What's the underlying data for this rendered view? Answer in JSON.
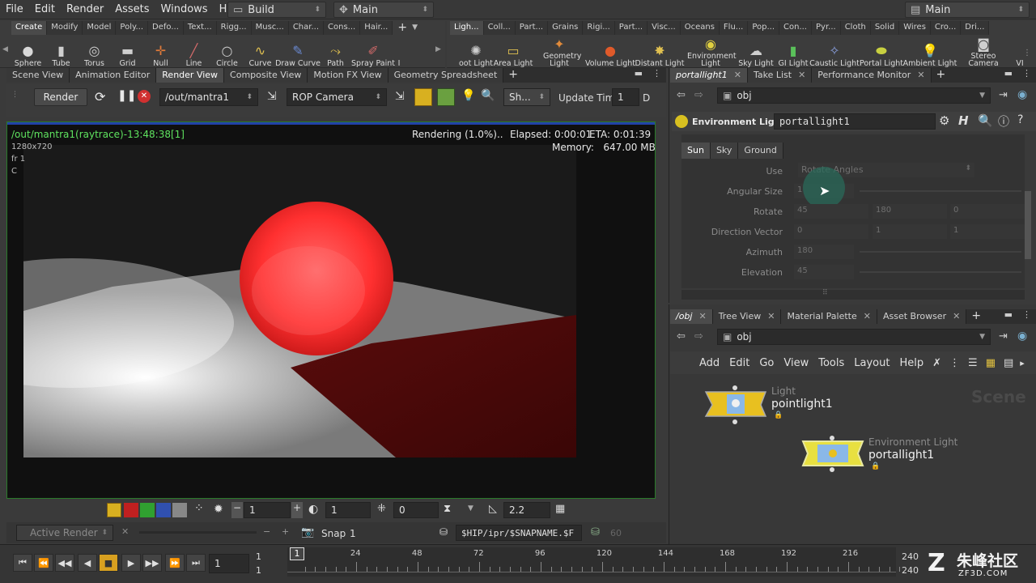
{
  "menubar": {
    "items": [
      "File",
      "Edit",
      "Render",
      "Assets",
      "Windows",
      "Help"
    ],
    "build_desk": "Build",
    "main_desk": "Main",
    "right_desk": "Main"
  },
  "shelf_left": {
    "tabs": [
      "Create",
      "Modify",
      "Model",
      "Poly...",
      "Defo...",
      "Text...",
      "Rigg...",
      "Musc...",
      "Char...",
      "Cons...",
      "Hair..."
    ],
    "tools": [
      "Sphere",
      "Tube",
      "Torus",
      "Grid",
      "Null",
      "Line",
      "Circle",
      "Curve",
      "Draw Curve",
      "Path",
      "Spray Paint",
      "I"
    ]
  },
  "shelf_right": {
    "tabs": [
      "Ligh...",
      "Coll...",
      "Part...",
      "Grains",
      "Rigi...",
      "Part...",
      "Visc...",
      "Oceans",
      "Flu...",
      "Pop...",
      "Con...",
      "Pyr...",
      "Cloth",
      "Solid",
      "Wires",
      "Cro...",
      "Dri..."
    ],
    "tools": [
      "oot Light",
      "Area Light",
      "Geometry Light",
      "Volume Light",
      "Distant Light",
      "Environment Light",
      "Sky Light",
      "GI Light",
      "Caustic Light",
      "Portal Light",
      "Ambient Light",
      "Stereo Camera",
      "VI"
    ]
  },
  "left_panetabs": [
    "Scene View",
    "Animation Editor",
    "Render View",
    "Composite View",
    "Motion FX View",
    "Geometry Spreadsheet"
  ],
  "render_toolbar": {
    "render_label": "Render",
    "output_path": "/out/mantra1",
    "camera": "ROP Camera",
    "sh_label": "Sh...",
    "update_time_label": "Update Time",
    "update_time_value": "1",
    "d_label": "D"
  },
  "viewer": {
    "title": "/out/mantra1(raytrace)-13:48:38[1]",
    "resolution": "1280x720",
    "frame": "fr 1",
    "channel": "C",
    "status": "Rendering (1.0%)..",
    "elapsed": "Elapsed: 0:00:01",
    "eta": "ETA: 0:01:39",
    "memory": "Memory:   647.00 MB"
  },
  "viewer_bottom": {
    "field1": "1",
    "field2": "1",
    "field3": "0",
    "gamma": "2.2",
    "active_render": "Active Render",
    "snap": "Snap",
    "snap_value": "1",
    "snap_path": "$HIP/ipr/$SNAPNAME.$F",
    "snap_num": "60"
  },
  "right_top_panetabs": [
    "portallight1",
    "Take List",
    "Performance Monitor"
  ],
  "param_pane": {
    "path": "obj",
    "node_type": "Environment Light",
    "node_name": "portallight1",
    "tabs": [
      "Sun",
      "Sky",
      "Ground"
    ],
    "params": [
      {
        "label": "Use",
        "value": "Rotate Angles"
      },
      {
        "label": "Angular Size",
        "value": "1"
      },
      {
        "label": "Rotate",
        "values": [
          "45",
          "180",
          "0"
        ]
      },
      {
        "label": "Direction Vector",
        "values": [
          "0",
          "1",
          "1"
        ]
      },
      {
        "label": "Azimuth",
        "value": "180"
      },
      {
        "label": "Elevation",
        "value": "45"
      }
    ]
  },
  "right_bottom_panetabs": [
    "/obj",
    "Tree View",
    "Material Palette",
    "Asset Browser"
  ],
  "network": {
    "path": "obj",
    "menu": [
      "Add",
      "Edit",
      "Go",
      "View",
      "Tools",
      "Layout",
      "Help"
    ],
    "watermark": "Scene",
    "nodes": [
      {
        "type": "Light",
        "name": "pointlight1"
      },
      {
        "type": "Environment Light",
        "name": "portallight1"
      }
    ]
  },
  "timeline": {
    "current_frame": "1",
    "start": "1",
    "start2": "1",
    "end": "240",
    "end2": "240",
    "marker": "1",
    "ticks": [
      "24",
      "48",
      "72",
      "96",
      "120",
      "144",
      "168",
      "192",
      "216"
    ]
  },
  "watermark": {
    "text": "朱峰社区",
    "url": "ZF3D.COM"
  }
}
